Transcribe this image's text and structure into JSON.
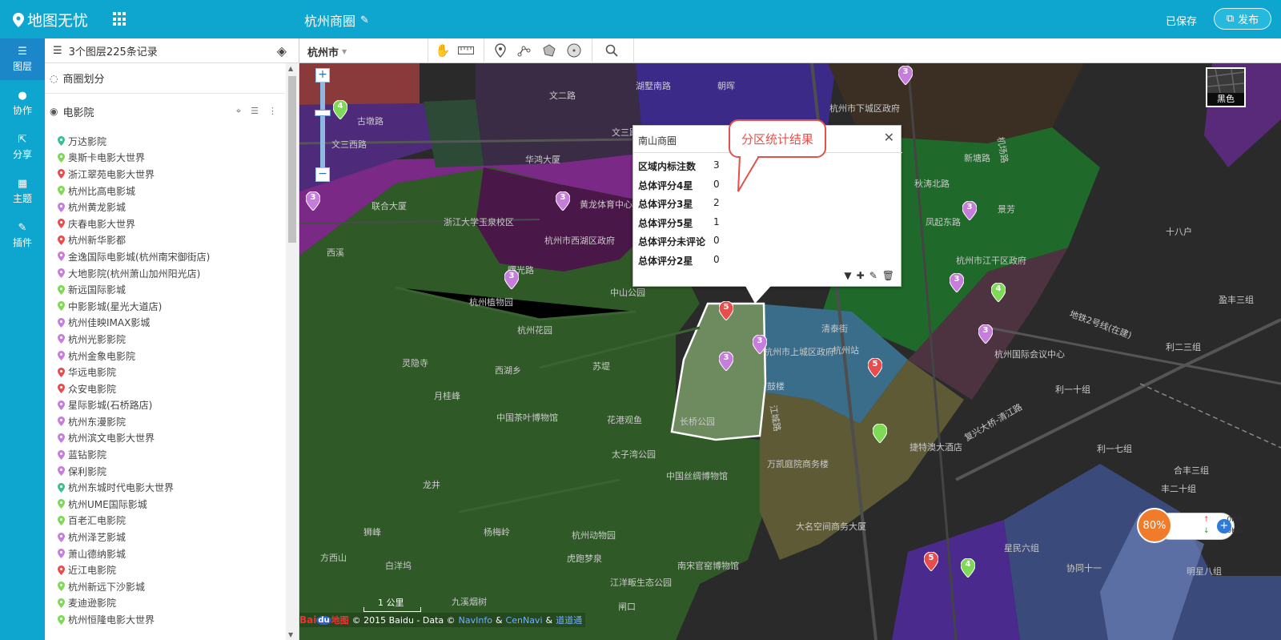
{
  "header": {
    "logo_text": "地图无忧",
    "map_title": "杭州商圈",
    "saved_text": "已保存",
    "publish_label": "发布"
  },
  "nav": [
    {
      "label": "图层",
      "icon": "list-icon",
      "active": true
    },
    {
      "label": "协作",
      "icon": "user-icon",
      "active": false
    },
    {
      "label": "分享",
      "icon": "share-icon",
      "active": false
    },
    {
      "label": "主题",
      "icon": "grid-icon",
      "active": false
    },
    {
      "label": "插件",
      "icon": "wrench-icon",
      "active": false
    }
  ],
  "panel": {
    "summary": "3个图层225条记录",
    "layers": [
      {
        "name": "商圈划分"
      },
      {
        "name": "电影院"
      }
    ],
    "cinemas": [
      {
        "name": "万达影院",
        "color": "#3cbf8f"
      },
      {
        "name": "奥斯卡电影大世界",
        "color": "#7ed957"
      },
      {
        "name": "浙江翠苑电影大世界",
        "color": "#e84d4d"
      },
      {
        "name": "杭州比高电影城",
        "color": "#7ed957"
      },
      {
        "name": "杭州黄龙影城",
        "color": "#c77ddb"
      },
      {
        "name": "庆春电影大世界",
        "color": "#e84d4d"
      },
      {
        "name": "杭州新华影都",
        "color": "#e84d4d"
      },
      {
        "name": "金逸国际电影城(杭州南宋御街店)",
        "color": "#c77ddb"
      },
      {
        "name": "大地影院(杭州萧山加州阳光店)",
        "color": "#c77ddb"
      },
      {
        "name": "新远国际影城",
        "color": "#7ed957"
      },
      {
        "name": "中影影城(星光大道店)",
        "color": "#7ed957"
      },
      {
        "name": "杭州佳映IMAX影城",
        "color": "#c77ddb"
      },
      {
        "name": "杭州光影影院",
        "color": "#c77ddb"
      },
      {
        "name": "杭州金象电影院",
        "color": "#c77ddb"
      },
      {
        "name": "华远电影院",
        "color": "#e84d4d"
      },
      {
        "name": "众安电影院",
        "color": "#e84d4d"
      },
      {
        "name": "星际影城(石桥路店)",
        "color": "#c77ddb"
      },
      {
        "name": "杭州东漫影院",
        "color": "#c77ddb"
      },
      {
        "name": "杭州滨文电影大世界",
        "color": "#c77ddb"
      },
      {
        "name": "蓝钻影院",
        "color": "#c77ddb"
      },
      {
        "name": "保利影院",
        "color": "#c77ddb"
      },
      {
        "name": "杭州东城时代电影大世界",
        "color": "#3cbf8f"
      },
      {
        "name": "杭州UME国际影城",
        "color": "#7ed957"
      },
      {
        "name": "百老汇电影院",
        "color": "#7ed957"
      },
      {
        "name": "杭州泽艺影城",
        "color": "#c77ddb"
      },
      {
        "name": "萧山德纳影城",
        "color": "#c77ddb"
      },
      {
        "name": "近江电影院",
        "color": "#e84d4d"
      },
      {
        "name": "杭州新远下沙影城",
        "color": "#7ed957"
      },
      {
        "name": "麦迪逊影院",
        "color": "#7ed957"
      },
      {
        "name": "杭州恒隆电影大世界",
        "color": "#7ed957"
      }
    ]
  },
  "toolbar": {
    "city": "杭州市"
  },
  "map": {
    "basemap_label": "黑色",
    "callout_text": "分区统计结果",
    "popup": {
      "title": "南山商圈",
      "stats": [
        {
          "label": "区域内标注数",
          "value": "3"
        },
        {
          "label": "总体评分4星",
          "value": "0"
        },
        {
          "label": "总体评分3星",
          "value": "2"
        },
        {
          "label": "总体评分5星",
          "value": "1"
        },
        {
          "label": "总体评分未评论",
          "value": "0"
        },
        {
          "label": "总体评分2星",
          "value": "0"
        }
      ]
    },
    "place_labels": [
      "古墩路",
      "文三西路",
      "文三路",
      "文二路",
      "华鸿大厦",
      "联合大厦",
      "西溪",
      "浙江大学玉泉校区",
      "杭州市西湖区政府",
      "黄龙体育中心",
      "曙光路",
      "杭州植物园",
      "杭州花园",
      "灵隐寺",
      "西湖乡",
      "月桂峰",
      "苏堤",
      "中国茶叶博物馆",
      "花港观鱼",
      "长桥公园",
      "太子湾公园",
      "中国丝绸博物馆",
      "龙井",
      "狮峰",
      "杨梅岭",
      "杭州动物园",
      "方西山",
      "白洋坞",
      "虎跑梦泉",
      "南宋官窑博物馆",
      "江洋畈生态公园",
      "九溪烟树",
      "闸口",
      "中山公园",
      "湖墅南路",
      "朝晖",
      "杭州市下城区政府",
      "新塘路",
      "秋涛北路",
      "凤起东路",
      "景芳",
      "杭州市江干区政府",
      "清泰街",
      "杭州站",
      "杭州市上城区政府",
      "杭州国际会议中心",
      "鼓楼",
      "万凯庭院商务楼",
      "大名空间商务大厦",
      "捷特澳大酒店",
      "十八户",
      "利一十组",
      "利二三组",
      "利一七组",
      "合丰三组",
      "丰二十组",
      "协同十一",
      "明星八组",
      "星民六组",
      "盈丰三组"
    ],
    "road_labels": [
      "地铁2号线(在建)",
      "复兴大桥-清江路",
      "机场路",
      "江城路"
    ],
    "scale_text": "1 公里",
    "copyright": {
      "logo_bai": "Bai",
      "logo_du": "du",
      "logo_map": "地图",
      "text": "© 2015 Baidu - Data ©",
      "navinfo": "NavInfo",
      "amp": "&",
      "cennavi": "CenNavi",
      "amp2": "&",
      "daodaotong": "道道通"
    },
    "speed": {
      "percent": "80%",
      "up": "0K/s",
      "down": "0K/s"
    }
  },
  "colors": {
    "header_bg": "#0ea5cf",
    "nav_active": "#1b86c8",
    "marker_red": "#e84d4d",
    "marker_purple": "#c77ddb",
    "marker_green": "#7ed957",
    "callout_red": "#e4504b"
  }
}
